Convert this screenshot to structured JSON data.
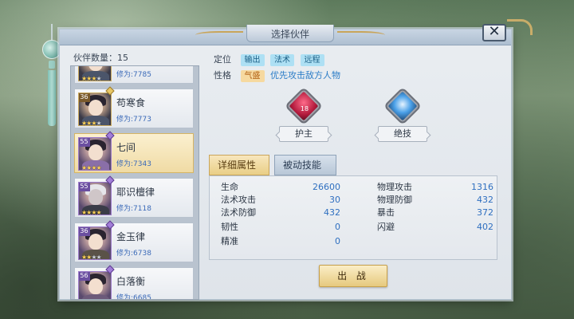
{
  "window": {
    "title": "选择伙伴",
    "close_label": "✕"
  },
  "partners": {
    "count_label": "伙伴数量：15",
    "items": [
      {
        "name": "",
        "cultivation": "修为:7785",
        "level": "",
        "stars": 3,
        "selected": false,
        "frame": "gold"
      },
      {
        "name": "苟寒食",
        "cultivation": "修为:7773",
        "level": "36",
        "stars": 3,
        "selected": false,
        "frame": "gold"
      },
      {
        "name": "七间",
        "cultivation": "修为:7343",
        "level": "55",
        "stars": 4,
        "selected": true,
        "frame": "purple"
      },
      {
        "name": "耶识檀律",
        "cultivation": "修为:7118",
        "level": "55",
        "stars": 4,
        "selected": false,
        "frame": "purple"
      },
      {
        "name": "金玉律",
        "cultivation": "修为:6738",
        "level": "36",
        "stars": 2,
        "selected": false,
        "frame": "purple"
      },
      {
        "name": "白落衡",
        "cultivation": "修为:6685",
        "level": "56",
        "stars": 3,
        "selected": false,
        "frame": "purple"
      }
    ]
  },
  "detail": {
    "position_label": "定位",
    "position_tags": [
      "输出",
      "法术",
      "远程"
    ],
    "trait_label": "性格",
    "trait_tag": "气盛",
    "trait_desc": "优先攻击敌方人物",
    "skills": [
      {
        "label": "护主",
        "level": "18",
        "icon": "shield-skill-icon"
      },
      {
        "label": "绝技",
        "level": "",
        "icon": "blade-skill-icon"
      }
    ],
    "tabs": [
      "详细属性",
      "被动技能"
    ],
    "stats_left": [
      {
        "k": "生命",
        "v": "26600"
      },
      {
        "k": "法术攻击",
        "v": "30"
      },
      {
        "k": "法术防御",
        "v": "432"
      },
      {
        "k": "韧性",
        "v": "0"
      },
      {
        "k": "精准",
        "v": "0"
      }
    ],
    "stats_right": [
      {
        "k": "物理攻击",
        "v": "1316"
      },
      {
        "k": "物理防御",
        "v": "432"
      },
      {
        "k": "暴击",
        "v": "372"
      },
      {
        "k": "闪避",
        "v": "402"
      }
    ],
    "battle_label": "出 战"
  },
  "colors": {
    "accent_gold": "#e6c97e",
    "stat_value": "#2f6fc0",
    "tag_blue": "#aee0f4",
    "tag_orange": "#f6d9a0"
  }
}
